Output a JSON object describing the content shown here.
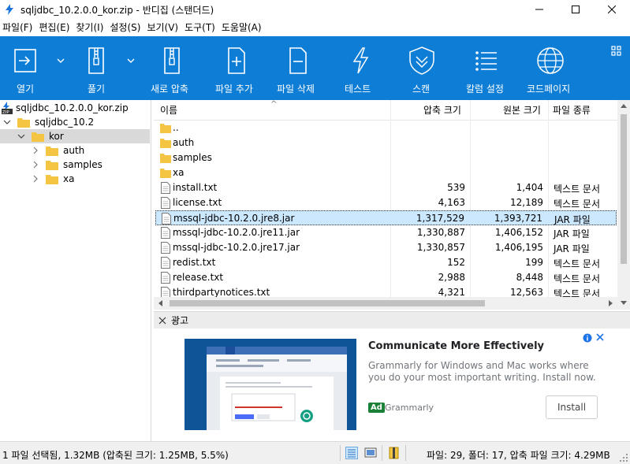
{
  "window": {
    "title": "sqljdbc_10.2.0.0_kor.zip - 반디집 (스탠더드)"
  },
  "menu": [
    "파일(F)",
    "편집(E)",
    "찾기(I)",
    "설정(S)",
    "보기(V)",
    "도구(T)",
    "도움말(A)"
  ],
  "toolbar": {
    "buttons": [
      {
        "label": "열기",
        "icon": "open-icon"
      },
      {
        "label": "풀기",
        "icon": "extract-icon"
      },
      {
        "label": "새로 압축",
        "icon": "new-archive-icon"
      },
      {
        "label": "파일 추가",
        "icon": "add-file-icon"
      },
      {
        "label": "파일 삭제",
        "icon": "delete-file-icon"
      },
      {
        "label": "테스트",
        "icon": "test-icon"
      },
      {
        "label": "스캔",
        "icon": "scan-icon"
      },
      {
        "label": "칼럼 설정",
        "icon": "column-settings-icon"
      },
      {
        "label": "코드페이지",
        "icon": "codepage-icon"
      }
    ]
  },
  "tree": {
    "root": "sqljdbc_10.2.0.0_kor.zip",
    "level1": "sqljdbc_10.2",
    "selected": "kor",
    "children": [
      "auth",
      "samples",
      "xa"
    ]
  },
  "list": {
    "headers": {
      "name": "이름",
      "packed": "압축 크기",
      "original": "원본 크기",
      "type": "파일 종류"
    },
    "rows": [
      {
        "name": "..",
        "packed": "",
        "original": "",
        "type": "",
        "kind": "folder"
      },
      {
        "name": "auth",
        "packed": "",
        "original": "",
        "type": "",
        "kind": "folder"
      },
      {
        "name": "samples",
        "packed": "",
        "original": "",
        "type": "",
        "kind": "folder"
      },
      {
        "name": "xa",
        "packed": "",
        "original": "",
        "type": "",
        "kind": "folder"
      },
      {
        "name": "install.txt",
        "packed": "539",
        "original": "1,404",
        "type": "텍스트 문서",
        "kind": "file"
      },
      {
        "name": "license.txt",
        "packed": "4,163",
        "original": "12,189",
        "type": "텍스트 문서",
        "kind": "file"
      },
      {
        "name": "mssql-jdbc-10.2.0.jre8.jar",
        "packed": "1,317,529",
        "original": "1,393,721",
        "type": "JAR 파일",
        "kind": "file",
        "selected": true
      },
      {
        "name": "mssql-jdbc-10.2.0.jre11.jar",
        "packed": "1,330,887",
        "original": "1,406,152",
        "type": "JAR 파일",
        "kind": "file"
      },
      {
        "name": "mssql-jdbc-10.2.0.jre17.jar",
        "packed": "1,330,857",
        "original": "1,406,195",
        "type": "JAR 파일",
        "kind": "file"
      },
      {
        "name": "redist.txt",
        "packed": "152",
        "original": "199",
        "type": "텍스트 문서",
        "kind": "file"
      },
      {
        "name": "release.txt",
        "packed": "2,988",
        "original": "8,448",
        "type": "텍스트 문서",
        "kind": "file"
      },
      {
        "name": "thirdpartynotices.txt",
        "packed": "4,321",
        "original": "12,563",
        "type": "텍스트 문서",
        "kind": "file"
      }
    ]
  },
  "ad": {
    "panel_title": "광고",
    "headline": "Communicate More Effectively",
    "description": "Grammarly for Windows and Mac works where you do your most important writing. Install now.",
    "badge": "Ad",
    "advertiser": "Grammarly",
    "cta": "Install"
  },
  "status": {
    "left": "1 파일 선택됨, 1.32MB (압축된 크기: 1.25MB, 5.5%)",
    "right": "파일: 29, 폴더: 17, 압축 파일 크기: 4.29MB"
  },
  "colors": {
    "toolbar_bg": "#0e7dd6",
    "folder": "#f4c542",
    "selection": "#cce8ff"
  }
}
